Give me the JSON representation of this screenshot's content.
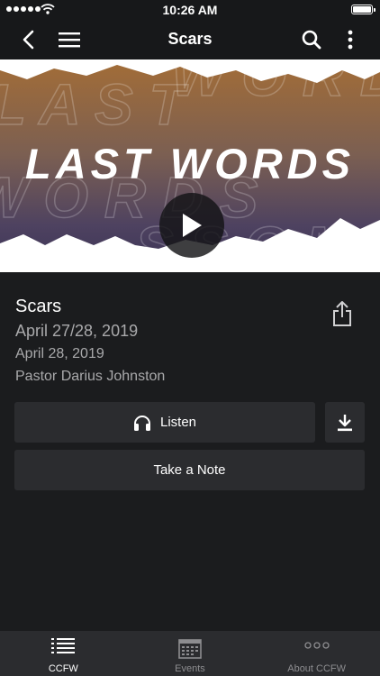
{
  "status_bar": {
    "time": "10:26 AM"
  },
  "nav": {
    "title": "Scars"
  },
  "hero": {
    "title": "LAST WORDS"
  },
  "sermon": {
    "title": "Scars",
    "series_date": "April 27/28, 2019",
    "date": "April 28, 2019",
    "speaker": "Pastor Darius Johnston"
  },
  "actions": {
    "listen_label": "Listen",
    "note_label": "Take a Note"
  },
  "tabs": [
    {
      "label": "CCFW",
      "icon": "list-icon",
      "active": true
    },
    {
      "label": "Events",
      "icon": "calendar-icon",
      "active": false
    },
    {
      "label": "About CCFW",
      "icon": "more-icon",
      "active": false
    }
  ],
  "colors": {
    "background": "#1b1c1e",
    "bar": "#17181a",
    "button": "#2b2c2f",
    "secondary_text": "#a9a9ab"
  }
}
